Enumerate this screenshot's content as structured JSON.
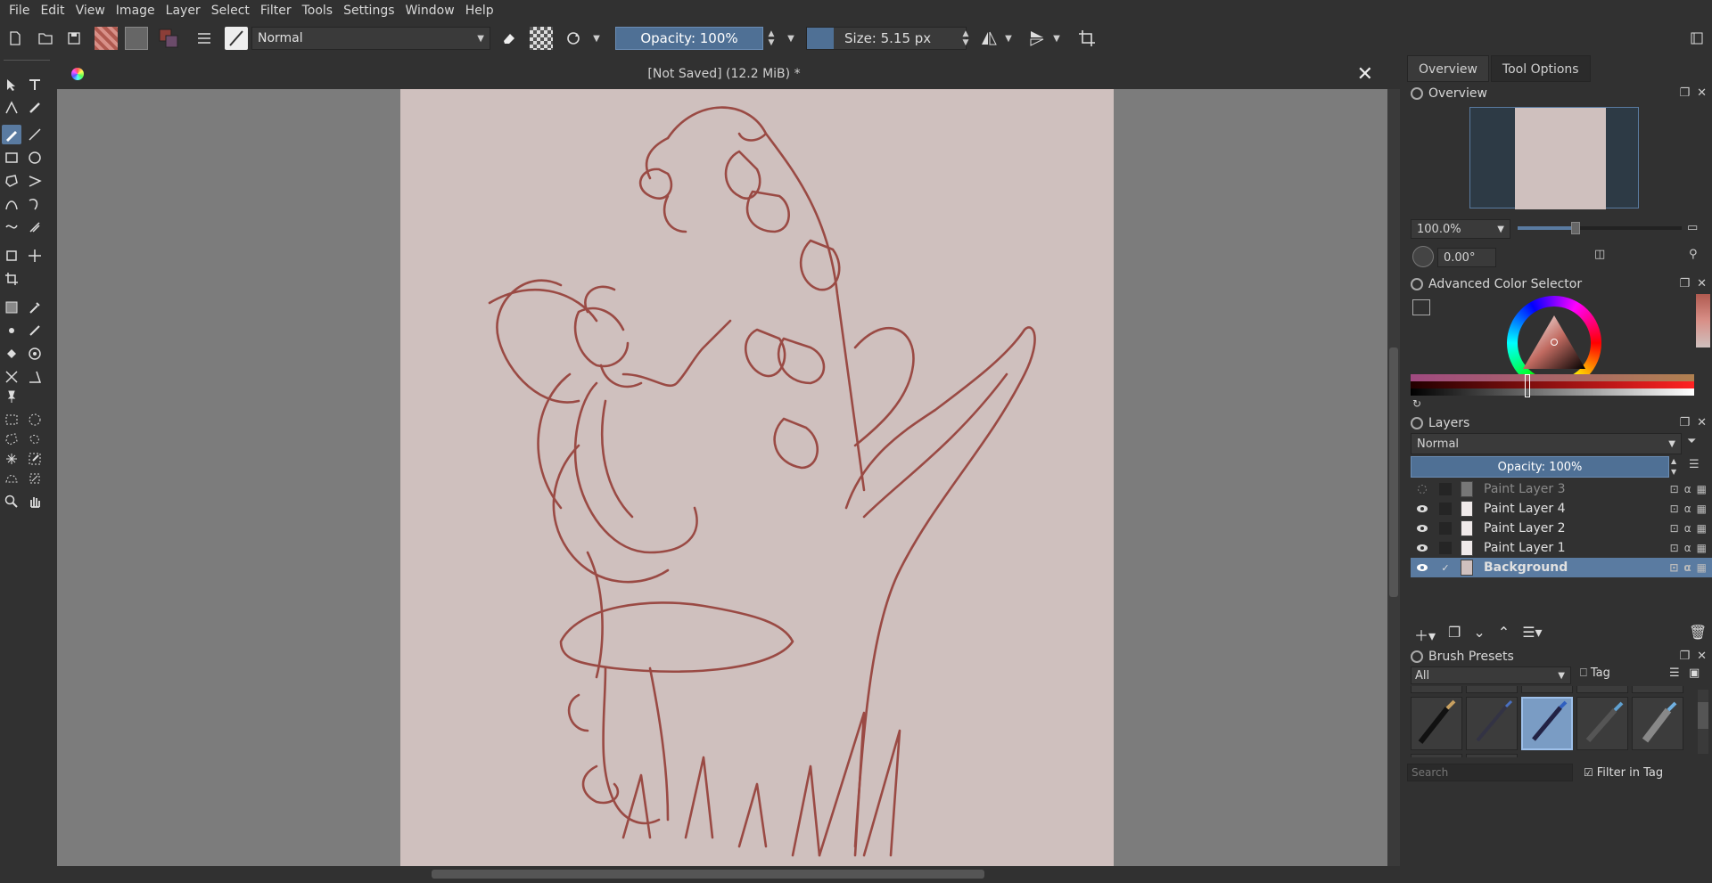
{
  "menu": [
    "File",
    "Edit",
    "View",
    "Image",
    "Layer",
    "Select",
    "Filter",
    "Tools",
    "Settings",
    "Window",
    "Help"
  ],
  "toolbar": {
    "blend_mode": "Normal",
    "opacity": "Opacity: 100%",
    "size": "Size: 5.15 px",
    "fg_color": "#8b3e38",
    "accent": "#4f7095"
  },
  "document": {
    "title": "[Not Saved]  (12.2 MiB) *",
    "paper_color": "#cfc0be",
    "line_color": "#9a4a44"
  },
  "docker": {
    "tabs": [
      "Overview",
      "Tool Options"
    ],
    "overview": {
      "title": "Overview",
      "zoom": "100.0%",
      "rotation": "0.00°"
    },
    "color_selector": {
      "title": "Advanced Color Selector"
    },
    "layers": {
      "title": "Layers",
      "blend_mode": "Normal",
      "opacity": "Opacity:  100%",
      "items": [
        {
          "name": "Paint Layer 3",
          "visible": false,
          "selected": false
        },
        {
          "name": "Paint Layer 4",
          "visible": true,
          "selected": false
        },
        {
          "name": "Paint Layer 2",
          "visible": true,
          "selected": false
        },
        {
          "name": "Paint Layer 1",
          "visible": true,
          "selected": false
        },
        {
          "name": "Background",
          "visible": true,
          "selected": true
        }
      ]
    },
    "brush_presets": {
      "title": "Brush Presets",
      "filter": "All",
      "tag_label": "Tag",
      "search_placeholder": "Search",
      "filter_in_tag": "Filter in Tag"
    }
  }
}
